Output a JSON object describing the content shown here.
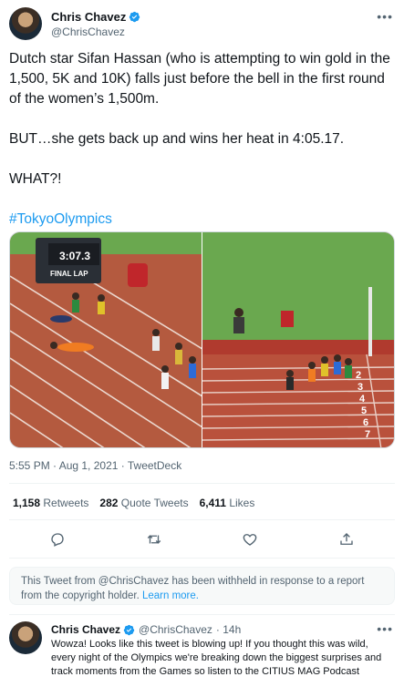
{
  "tweet": {
    "display_name": "Chris Chavez",
    "handle": "@ChrisChavez",
    "text_p1": "Dutch star Sifan Hassan (who is attempting to win gold in the 1,500, 5K and 10K) falls just before the bell in the first round of the women’s 1,500m.",
    "text_p2": "BUT…she gets back up and wins her heat in 4:05.17.",
    "text_p3": "WHAT?!",
    "hashtag": "#TokyoOlympics",
    "timestamp": "5:55 PM · Aug 1, 2021 · TweetDeck",
    "media": {
      "scoreboard_time": "3:07.3",
      "scoreboard_label": "FINAL LAP",
      "lane_numbers": [
        "1",
        "2",
        "3",
        "4",
        "5",
        "6",
        "7"
      ]
    }
  },
  "stats": {
    "retweets_count": "1,158",
    "retweets_label": "Retweets",
    "quotes_count": "282",
    "quotes_label": "Quote Tweets",
    "likes_count": "6,411",
    "likes_label": "Likes"
  },
  "actions": {
    "icons": [
      "reply-icon",
      "retweet-icon",
      "like-icon",
      "share-icon"
    ]
  },
  "notice": {
    "text": "This Tweet from @ChrisChavez has been withheld in response to a report from the copyright holder.",
    "link": "Learn more."
  },
  "reply": {
    "display_name": "Chris Chavez",
    "handle": "@ChrisChavez",
    "time": "· 14h",
    "text": "Wowza! Looks like this tweet is blowing up! If you thought this was wild, every night of the Olympics we're breaking down the biggest surprises and track moments from the Games so listen to the CITIUS MAG Podcast"
  },
  "colors": {
    "accent": "#1d9bf0",
    "text": "#0f1419",
    "secondary": "#536471",
    "track": "#b45a3f",
    "field": "#6aa84f"
  }
}
